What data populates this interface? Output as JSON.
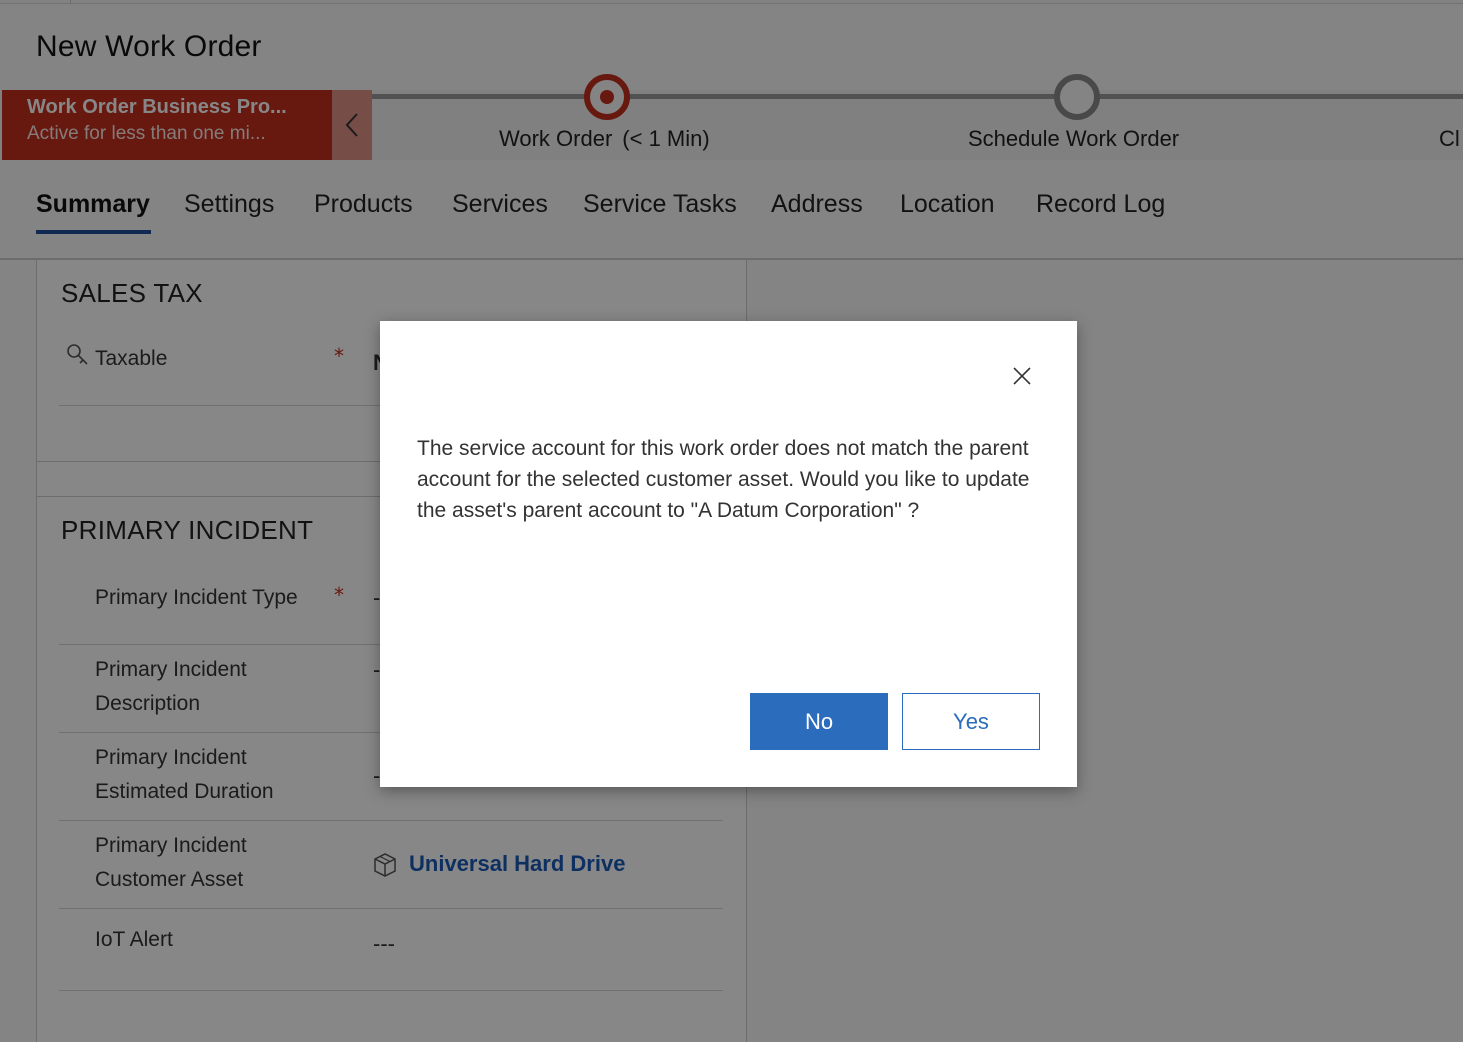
{
  "page": {
    "title": "New Work Order"
  },
  "bpf": {
    "process_name": "Work Order Business Pro...",
    "process_duration": "Active for less than one mi...",
    "collapse_icon": "chevron-left-icon",
    "stages": [
      {
        "label": "Work Order",
        "duration": "(< 1 Min)",
        "state": "active"
      },
      {
        "label": "Schedule Work Order",
        "state": "idle"
      },
      {
        "label": "Cl",
        "state": "clipped"
      }
    ],
    "colors": {
      "active": "#c22f1d",
      "idle": "#8a8a8a"
    }
  },
  "tabs": [
    "Summary",
    "Settings",
    "Products",
    "Services",
    "Service Tasks",
    "Address",
    "Location",
    "Record Log"
  ],
  "active_tab": "Summary",
  "sections": {
    "sales_tax": {
      "title": "SALES TAX",
      "fields": [
        {
          "label": "Taxable",
          "required": true,
          "icon": "lock-key-icon",
          "value": "N"
        }
      ]
    },
    "primary_incident": {
      "title": "PRIMARY INCIDENT",
      "fields": [
        {
          "label": "Primary Incident Type",
          "required": true,
          "value": "-"
        },
        {
          "label_line1": "Primary Incident",
          "label_line2": "Description",
          "value": "-"
        },
        {
          "label_line1": "Primary Incident",
          "label_line2": "Estimated Duration",
          "value": "-"
        },
        {
          "label_line1": "Primary Incident",
          "label_line2": "Customer Asset",
          "value": "Universal Hard Drive",
          "icon": "asset-box-icon"
        },
        {
          "label": "IoT Alert",
          "value": "---"
        }
      ]
    }
  },
  "dialog": {
    "message": "The service account for this work order does not match the parent account for the selected customer asset. Would you like to update the asset's parent account to \"A Datum Corporation\" ?",
    "buttons": {
      "no": "No",
      "yes": "Yes"
    },
    "close_icon": "close-icon",
    "colors": {
      "primary": "#2b6cbd"
    }
  }
}
